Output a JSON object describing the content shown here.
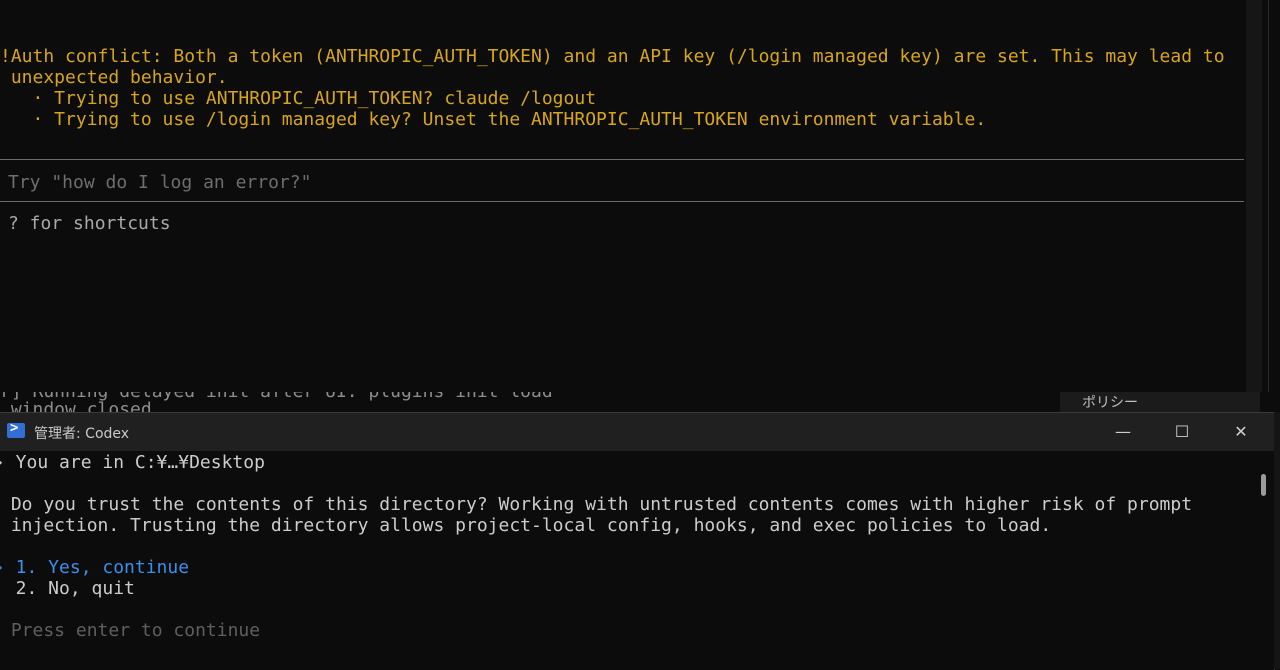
{
  "top_terminal": {
    "auth_warning": [
      "!Auth conflict: Both a token (ANTHROPIC_AUTH_TOKEN) and an API key (/login managed key) are set. This may lead to",
      " unexpected behavior.",
      "   · Trying to use ANTHROPIC_AUTH_TOKEN? claude /logout",
      "   · Trying to use /login managed key? Unset the ANTHROPIC_AUTH_TOKEN environment variable."
    ],
    "prompt_placeholder": "Try \"how do I log an error?\"",
    "shortcuts_hint": "? for shortcuts"
  },
  "background_window": {
    "log_line_1": "r] Running delayed init after UI: plugins init load",
    "log_line_2": " window closed",
    "tab_label": "ポリシー"
  },
  "codex_window": {
    "title": "管理者: Codex",
    "controls": {
      "minimize": "—",
      "maximize": "☐",
      "close": "✕"
    },
    "location_line": "› You are in C:¥…¥Desktop",
    "trust_question": [
      " Do you trust the contents of this directory? Working with untrusted contents comes with higher risk of prompt",
      " injection. Trusting the directory allows project-local config, hooks, and exec policies to load."
    ],
    "options": [
      "› 1. Yes, continue",
      "  2. No, quit"
    ],
    "footer_hint": " Press enter to continue"
  },
  "colors": {
    "warning": "#d7a51b",
    "selected_option": "#3b8eea",
    "terminal_bg": "#0c0c0c",
    "titlebar_bg": "#202020"
  }
}
